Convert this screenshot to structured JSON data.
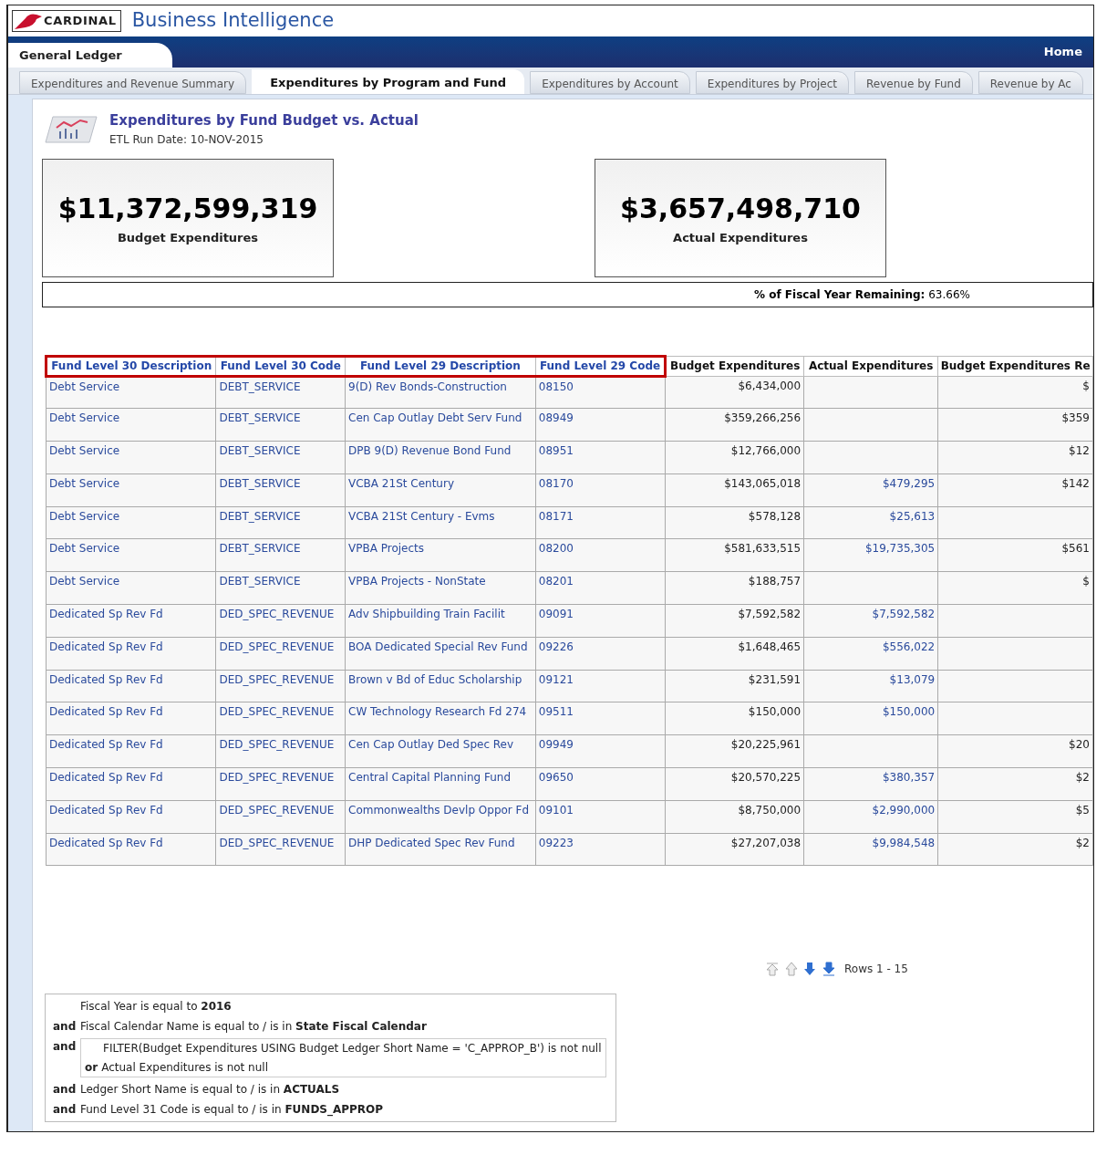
{
  "header": {
    "logo": "CARDINAL",
    "title": "Business Intelligence"
  },
  "nav": {
    "dashboard": "General Ledger",
    "home": "Home"
  },
  "tabs": [
    {
      "label": "Expenditures and Revenue Summary",
      "selected": false
    },
    {
      "label": "Expenditures by Program and Fund",
      "selected": true
    },
    {
      "label": "Expenditures by Account",
      "selected": false
    },
    {
      "label": "Expenditures by Project",
      "selected": false
    },
    {
      "label": "Revenue by Fund",
      "selected": false
    },
    {
      "label": "Revenue by Ac",
      "selected": false
    }
  ],
  "report": {
    "title": "Expenditures by Fund Budget vs. Actual",
    "subtitle": "ETL Run Date: 10-NOV-2015"
  },
  "kpis": [
    {
      "value": "$11,372,599,319",
      "label": "Budget Expenditures"
    },
    {
      "value": "$3,657,498,710",
      "label": "Actual Expenditures"
    }
  ],
  "fiscal_remaining": {
    "label": "% of Fiscal Year Remaining:",
    "value": "63.66%"
  },
  "table": {
    "columns": [
      {
        "label": "Fund Level 30 Description",
        "kind": "link",
        "highlighted": true
      },
      {
        "label": "Fund Level 30 Code",
        "kind": "link",
        "highlighted": true
      },
      {
        "label": "Fund Level 29 Description",
        "kind": "link",
        "highlighted": true
      },
      {
        "label": "Fund Level 29 Code",
        "kind": "link",
        "highlighted": true
      },
      {
        "label": "Budget Expenditures",
        "kind": "amount",
        "highlighted": false
      },
      {
        "label": "Actual Expenditures",
        "kind": "link_amount",
        "highlighted": false
      },
      {
        "label": "Budget Expenditures Re",
        "kind": "amount",
        "highlighted": false
      }
    ],
    "rows": [
      [
        "Debt Service",
        "DEBT_SERVICE",
        "9(D) Rev Bonds-Construction",
        "08150",
        "$6,434,000",
        null,
        "$"
      ],
      [
        "Debt Service",
        "DEBT_SERVICE",
        "Cen Cap Outlay Debt Serv Fund",
        "08949",
        "$359,266,256",
        null,
        "$359"
      ],
      [
        "Debt Service",
        "DEBT_SERVICE",
        "DPB 9(D) Revenue Bond Fund",
        "08951",
        "$12,766,000",
        null,
        "$12"
      ],
      [
        "Debt Service",
        "DEBT_SERVICE",
        "VCBA 21St Century",
        "08170",
        "$143,065,018",
        "$479,295",
        "$142"
      ],
      [
        "Debt Service",
        "DEBT_SERVICE",
        "VCBA 21St Century - Evms",
        "08171",
        "$578,128",
        "$25,613",
        null
      ],
      [
        "Debt Service",
        "DEBT_SERVICE",
        "VPBA Projects",
        "08200",
        "$581,633,515",
        "$19,735,305",
        "$561"
      ],
      [
        "Debt Service",
        "DEBT_SERVICE",
        "VPBA Projects - NonState",
        "08201",
        "$188,757",
        null,
        "$"
      ],
      [
        "Dedicated Sp Rev Fd",
        "DED_SPEC_REVENUE",
        "Adv Shipbuilding Train Facilit",
        "09091",
        "$7,592,582",
        "$7,592,582",
        null
      ],
      [
        "Dedicated Sp Rev Fd",
        "DED_SPEC_REVENUE",
        "BOA Dedicated Special Rev Fund",
        "09226",
        "$1,648,465",
        "$556,022",
        null
      ],
      [
        "Dedicated Sp Rev Fd",
        "DED_SPEC_REVENUE",
        "Brown v Bd of Educ Scholarship",
        "09121",
        "$231,591",
        "$13,079",
        null
      ],
      [
        "Dedicated Sp Rev Fd",
        "DED_SPEC_REVENUE",
        "CW Technology Research Fd 274",
        "09511",
        "$150,000",
        "$150,000",
        null
      ],
      [
        "Dedicated Sp Rev Fd",
        "DED_SPEC_REVENUE",
        "Cen Cap Outlay Ded Spec Rev",
        "09949",
        "$20,225,961",
        null,
        "$20"
      ],
      [
        "Dedicated Sp Rev Fd",
        "DED_SPEC_REVENUE",
        "Central Capital Planning Fund",
        "09650",
        "$20,570,225",
        "$380,357",
        "$2"
      ],
      [
        "Dedicated Sp Rev Fd",
        "DED_SPEC_REVENUE",
        "Commonwealths Devlp Oppor Fd",
        "09101",
        "$8,750,000",
        "$2,990,000",
        "$5"
      ],
      [
        "Dedicated Sp Rev Fd",
        "DED_SPEC_REVENUE",
        "DHP Dedicated Spec Rev Fund",
        "09223",
        "$27,207,038",
        "$9,984,548",
        "$2"
      ]
    ]
  },
  "pager": {
    "label": "Rows 1 - 15"
  },
  "filters": [
    {
      "kind": "line",
      "text": "Fiscal Year is equal to **2016**"
    },
    {
      "kind": "and",
      "text": "Fiscal Calendar Name is equal to / is in **State Fiscal Calendar**",
      "conj": "and"
    },
    {
      "kind": "group",
      "conj": "and",
      "lines": [
        "FILTER(Budget Expenditures USING Budget Ledger Short Name = 'C_APPROP_B') is not null"
      ],
      "or_conj": "or",
      "or_text": "Actual Expenditures is not null"
    },
    {
      "kind": "and",
      "text": "Ledger Short Name is equal to / is in **ACTUALS**",
      "conj": "and"
    },
    {
      "kind": "and",
      "text": "Fund Level 31 Code is equal to / is in **FUNDS_APPROP**",
      "conj": "and"
    }
  ]
}
